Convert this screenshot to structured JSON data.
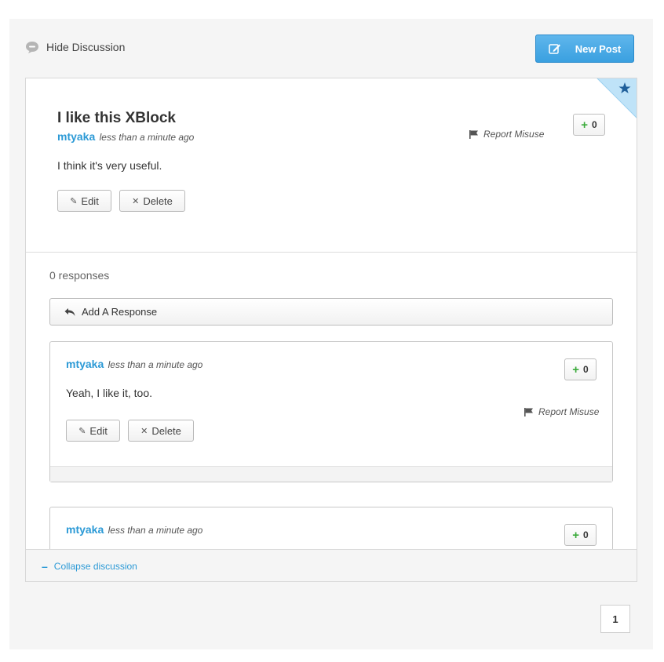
{
  "discussion": {
    "hide_label": "Hide Discussion",
    "new_post_label": "New Post",
    "collapse_label": "Collapse discussion",
    "page_number": "1",
    "accent_color": "#2c9ad6"
  },
  "post": {
    "title": "I like this XBlock",
    "author": "mtyaka",
    "time": "less than a minute ago",
    "body": "I think it's very useful.",
    "vote_count": "0",
    "report_label": "Report Misuse",
    "edit_label": "Edit",
    "delete_label": "Delete",
    "starred": true
  },
  "responses_section": {
    "count_label": "0 responses",
    "add_response_label": "Add A Response"
  },
  "responses": [
    {
      "author": "mtyaka",
      "time": "less than a minute ago",
      "body": "Yeah, I like it, too.",
      "vote_count": "0",
      "report_label": "Report Misuse",
      "edit_label": "Edit",
      "delete_label": "Delete"
    },
    {
      "author": "mtyaka",
      "time": "less than a minute ago",
      "vote_count": "0"
    }
  ]
}
